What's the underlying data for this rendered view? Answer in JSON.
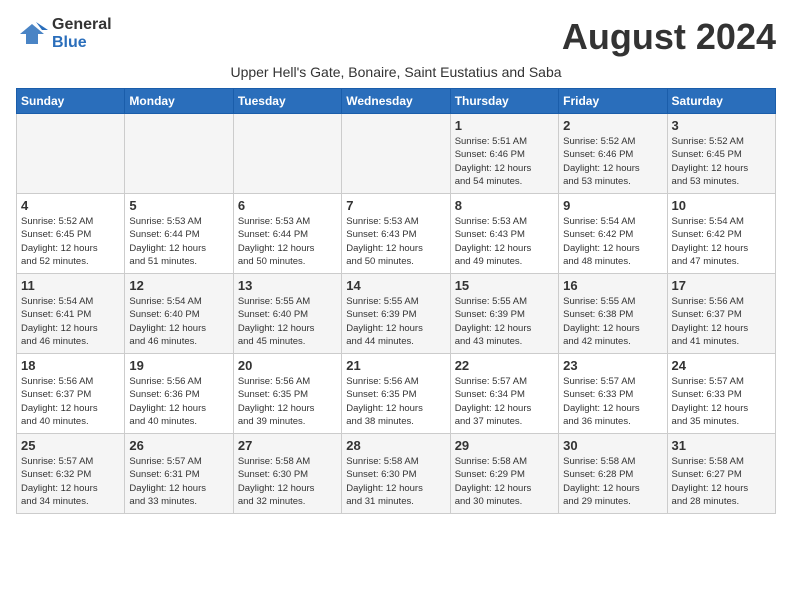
{
  "header": {
    "logo_line1": "General",
    "logo_line2": "Blue",
    "month_title": "August 2024",
    "subtitle": "Upper Hell's Gate, Bonaire, Saint Eustatius and Saba"
  },
  "weekdays": [
    "Sunday",
    "Monday",
    "Tuesday",
    "Wednesday",
    "Thursday",
    "Friday",
    "Saturday"
  ],
  "weeks": [
    [
      {
        "day": "",
        "info": ""
      },
      {
        "day": "",
        "info": ""
      },
      {
        "day": "",
        "info": ""
      },
      {
        "day": "",
        "info": ""
      },
      {
        "day": "1",
        "info": "Sunrise: 5:51 AM\nSunset: 6:46 PM\nDaylight: 12 hours\nand 54 minutes."
      },
      {
        "day": "2",
        "info": "Sunrise: 5:52 AM\nSunset: 6:46 PM\nDaylight: 12 hours\nand 53 minutes."
      },
      {
        "day": "3",
        "info": "Sunrise: 5:52 AM\nSunset: 6:45 PM\nDaylight: 12 hours\nand 53 minutes."
      }
    ],
    [
      {
        "day": "4",
        "info": "Sunrise: 5:52 AM\nSunset: 6:45 PM\nDaylight: 12 hours\nand 52 minutes."
      },
      {
        "day": "5",
        "info": "Sunrise: 5:53 AM\nSunset: 6:44 PM\nDaylight: 12 hours\nand 51 minutes."
      },
      {
        "day": "6",
        "info": "Sunrise: 5:53 AM\nSunset: 6:44 PM\nDaylight: 12 hours\nand 50 minutes."
      },
      {
        "day": "7",
        "info": "Sunrise: 5:53 AM\nSunset: 6:43 PM\nDaylight: 12 hours\nand 50 minutes."
      },
      {
        "day": "8",
        "info": "Sunrise: 5:53 AM\nSunset: 6:43 PM\nDaylight: 12 hours\nand 49 minutes."
      },
      {
        "day": "9",
        "info": "Sunrise: 5:54 AM\nSunset: 6:42 PM\nDaylight: 12 hours\nand 48 minutes."
      },
      {
        "day": "10",
        "info": "Sunrise: 5:54 AM\nSunset: 6:42 PM\nDaylight: 12 hours\nand 47 minutes."
      }
    ],
    [
      {
        "day": "11",
        "info": "Sunrise: 5:54 AM\nSunset: 6:41 PM\nDaylight: 12 hours\nand 46 minutes."
      },
      {
        "day": "12",
        "info": "Sunrise: 5:54 AM\nSunset: 6:40 PM\nDaylight: 12 hours\nand 46 minutes."
      },
      {
        "day": "13",
        "info": "Sunrise: 5:55 AM\nSunset: 6:40 PM\nDaylight: 12 hours\nand 45 minutes."
      },
      {
        "day": "14",
        "info": "Sunrise: 5:55 AM\nSunset: 6:39 PM\nDaylight: 12 hours\nand 44 minutes."
      },
      {
        "day": "15",
        "info": "Sunrise: 5:55 AM\nSunset: 6:39 PM\nDaylight: 12 hours\nand 43 minutes."
      },
      {
        "day": "16",
        "info": "Sunrise: 5:55 AM\nSunset: 6:38 PM\nDaylight: 12 hours\nand 42 minutes."
      },
      {
        "day": "17",
        "info": "Sunrise: 5:56 AM\nSunset: 6:37 PM\nDaylight: 12 hours\nand 41 minutes."
      }
    ],
    [
      {
        "day": "18",
        "info": "Sunrise: 5:56 AM\nSunset: 6:37 PM\nDaylight: 12 hours\nand 40 minutes."
      },
      {
        "day": "19",
        "info": "Sunrise: 5:56 AM\nSunset: 6:36 PM\nDaylight: 12 hours\nand 40 minutes."
      },
      {
        "day": "20",
        "info": "Sunrise: 5:56 AM\nSunset: 6:35 PM\nDaylight: 12 hours\nand 39 minutes."
      },
      {
        "day": "21",
        "info": "Sunrise: 5:56 AM\nSunset: 6:35 PM\nDaylight: 12 hours\nand 38 minutes."
      },
      {
        "day": "22",
        "info": "Sunrise: 5:57 AM\nSunset: 6:34 PM\nDaylight: 12 hours\nand 37 minutes."
      },
      {
        "day": "23",
        "info": "Sunrise: 5:57 AM\nSunset: 6:33 PM\nDaylight: 12 hours\nand 36 minutes."
      },
      {
        "day": "24",
        "info": "Sunrise: 5:57 AM\nSunset: 6:33 PM\nDaylight: 12 hours\nand 35 minutes."
      }
    ],
    [
      {
        "day": "25",
        "info": "Sunrise: 5:57 AM\nSunset: 6:32 PM\nDaylight: 12 hours\nand 34 minutes."
      },
      {
        "day": "26",
        "info": "Sunrise: 5:57 AM\nSunset: 6:31 PM\nDaylight: 12 hours\nand 33 minutes."
      },
      {
        "day": "27",
        "info": "Sunrise: 5:58 AM\nSunset: 6:30 PM\nDaylight: 12 hours\nand 32 minutes."
      },
      {
        "day": "28",
        "info": "Sunrise: 5:58 AM\nSunset: 6:30 PM\nDaylight: 12 hours\nand 31 minutes."
      },
      {
        "day": "29",
        "info": "Sunrise: 5:58 AM\nSunset: 6:29 PM\nDaylight: 12 hours\nand 30 minutes."
      },
      {
        "day": "30",
        "info": "Sunrise: 5:58 AM\nSunset: 6:28 PM\nDaylight: 12 hours\nand 29 minutes."
      },
      {
        "day": "31",
        "info": "Sunrise: 5:58 AM\nSunset: 6:27 PM\nDaylight: 12 hours\nand 28 minutes."
      }
    ]
  ]
}
